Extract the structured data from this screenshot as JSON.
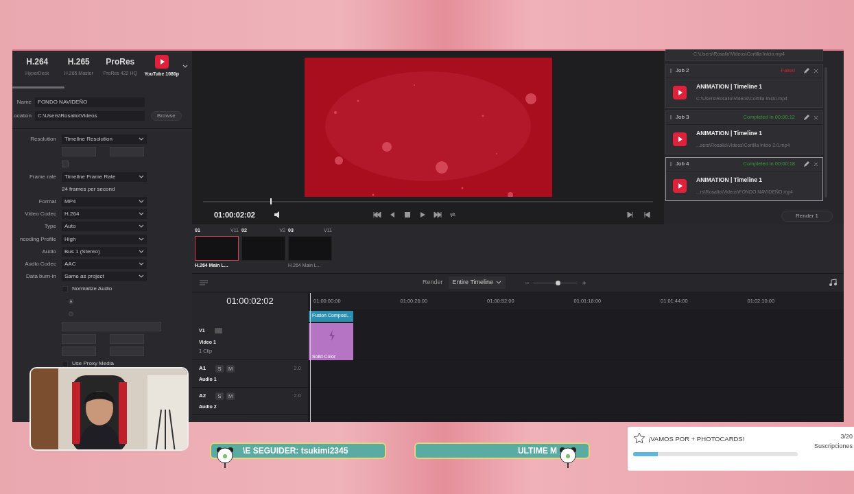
{
  "presets": [
    {
      "kind": "text",
      "title": "H.264",
      "subtitle": "HyperDeck",
      "selected": false
    },
    {
      "kind": "text",
      "title": "H.265",
      "subtitle": "H.265 Master",
      "selected": false
    },
    {
      "kind": "text",
      "title": "ProRes",
      "subtitle": "ProRes 422 HQ",
      "selected": false
    },
    {
      "kind": "youtube",
      "subtitle": "YouTube 1080p",
      "selected": true
    }
  ],
  "file": {
    "name_label": "Name",
    "name_value": "FONDO NAVIDEÑO",
    "location_label": "ocation",
    "location_value": "C:\\Users\\Rosalio\\Videos",
    "browse": "Browse"
  },
  "settings": [
    {
      "kind": "select",
      "label": "Resolution",
      "value": "Timeline Resolution"
    },
    {
      "kind": "dims"
    },
    {
      "kind": "disabled_check",
      "checked": false
    },
    {
      "kind": "select",
      "label": "Frame rate",
      "value": "Timeline Frame Rate"
    },
    {
      "kind": "note",
      "text": "24 frames per second"
    },
    {
      "kind": "select",
      "label": "Format",
      "value": "MP4"
    },
    {
      "kind": "select",
      "label": "Video Codec",
      "value": "H.264"
    },
    {
      "kind": "select",
      "label": "Type",
      "value": "Auto"
    },
    {
      "kind": "select",
      "label": "ncoding Profile",
      "value": "High"
    },
    {
      "kind": "select",
      "label": "Audio",
      "value": "Bus 1 (Stereo)"
    },
    {
      "kind": "select",
      "label": "Audio Codec",
      "value": "AAC"
    },
    {
      "kind": "select",
      "label": "Data burn-in",
      "value": "Same as project"
    },
    {
      "kind": "checkbox",
      "label": "Normalize Audio",
      "checked": false
    },
    {
      "kind": "disabled_radio",
      "selected": true
    },
    {
      "kind": "disabled_radio",
      "selected": false
    },
    {
      "kind": "disabled_select"
    },
    {
      "kind": "dims"
    },
    {
      "kind": "dims"
    },
    {
      "kind": "checkbox",
      "label": "Use Proxy Media",
      "checked": false
    }
  ],
  "viewer": {
    "timecode": "01:00:02:02",
    "level": 0.15
  },
  "render_queue": {
    "first_path": "C:\\Users\\Rosalio\\Videos\\Cortilla inicio.mp4",
    "jobs": [
      {
        "name": "Job 2",
        "status": "Failed",
        "kind": "failed",
        "title": "ANIMATION | Timeline 1",
        "path": "C:\\Users\\Rosalio\\Videos\\Cortilla inicio.mp4",
        "selected": false
      },
      {
        "name": "Job 3",
        "status": "Completed in 00:00:12",
        "kind": "completed",
        "title": "ANIMATION | Timeline 1",
        "path": "...sers\\Rosalio\\Videos\\Cortilla inicio 2.0.mp4",
        "selected": false
      },
      {
        "name": "Job 4",
        "status": "Completed in 00:00:18",
        "kind": "completed",
        "title": "ANIMATION | Timeline 1",
        "path": "...rs\\Rosalio\\Videos\\FONDO NAVIDEÑO.mp4",
        "selected": true
      }
    ],
    "button": "Render 1"
  },
  "clips": [
    {
      "number": "01",
      "track": "V11",
      "label": "H.264 Main L...",
      "selected": true
    },
    {
      "number": "02",
      "track": "V2",
      "selected": false
    },
    {
      "number": "03",
      "track": "V11",
      "label": "H.264 Main L...",
      "selected": false
    }
  ],
  "timeline": {
    "render_label": "Render",
    "render_value": "Entire Timeline",
    "zoom": {
      "level": 0.55
    },
    "timecode": "01:00:02:02",
    "ruler": [
      "01:00:00:00",
      "01:00:26:00",
      "01:00:52:00",
      "01:01:18:00",
      "01:01:44:00",
      "01:02:10:00"
    ],
    "video_tracks": [
      {
        "id": "V1",
        "name": "Video 1",
        "info": "1 Clip",
        "clips": [
          {
            "label": "Fusion Composi...",
            "kind": "fusion"
          },
          {
            "label": "Solid Color",
            "kind": "solid"
          }
        ]
      }
    ],
    "audio_tracks": [
      {
        "id": "A1",
        "name": "Audio 1",
        "solo": "S",
        "mute": "M",
        "channels": "2.0"
      },
      {
        "id": "A2",
        "name": "Audio 2",
        "solo": "S",
        "mute": "M",
        "channels": "2.0"
      }
    ]
  },
  "tickers": [
    "\\E SEGUIDER: tsukimi2345",
    "ULTIME M"
  ],
  "goal": {
    "title": "¡VAMOS POR + PHOTOCARDS!",
    "count": "3/20",
    "unit": "Suscripciones",
    "level": 0.15
  }
}
